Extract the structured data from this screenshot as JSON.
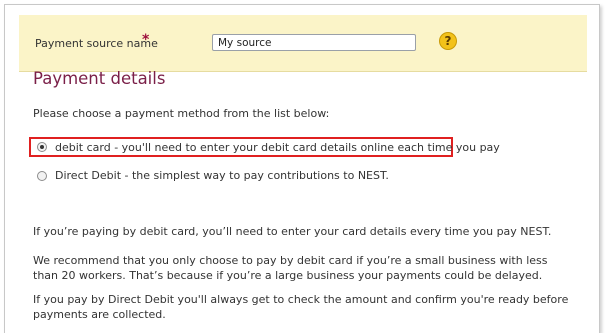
{
  "payment_source": {
    "label": "Payment source name",
    "required_marker": "*",
    "input_value": "My source",
    "help_icon": "question-mark-icon",
    "help_glyph": "?"
  },
  "payment_details": {
    "title": "Payment details",
    "instruction": "Please choose a payment method from the list below:",
    "options": [
      {
        "label": "debit card - you'll need to enter your debit card details online each time you pay",
        "selected": true,
        "highlighted": true
      },
      {
        "label": "Direct Debit - the simplest way to pay contributions to NEST.",
        "selected": false,
        "highlighted": false
      }
    ],
    "info_paragraphs": [
      "If you’re paying by debit card, you’ll need to enter your card details every time you pay NEST.",
      "We recommend that you only choose to pay by debit card if you’re a small business with less than 20 workers. That’s because if you’re a large business your payments could be delayed.",
      "If you pay by Direct Debit you'll always get to check the amount and confirm you're ready before payments are collected."
    ]
  },
  "colors": {
    "source_bar_bg": "#fbf4c8",
    "title_color": "#7a1f48",
    "highlight_border": "#e02020",
    "help_icon_bg": "#f3c21a",
    "required_star": "#9c0f3c"
  }
}
